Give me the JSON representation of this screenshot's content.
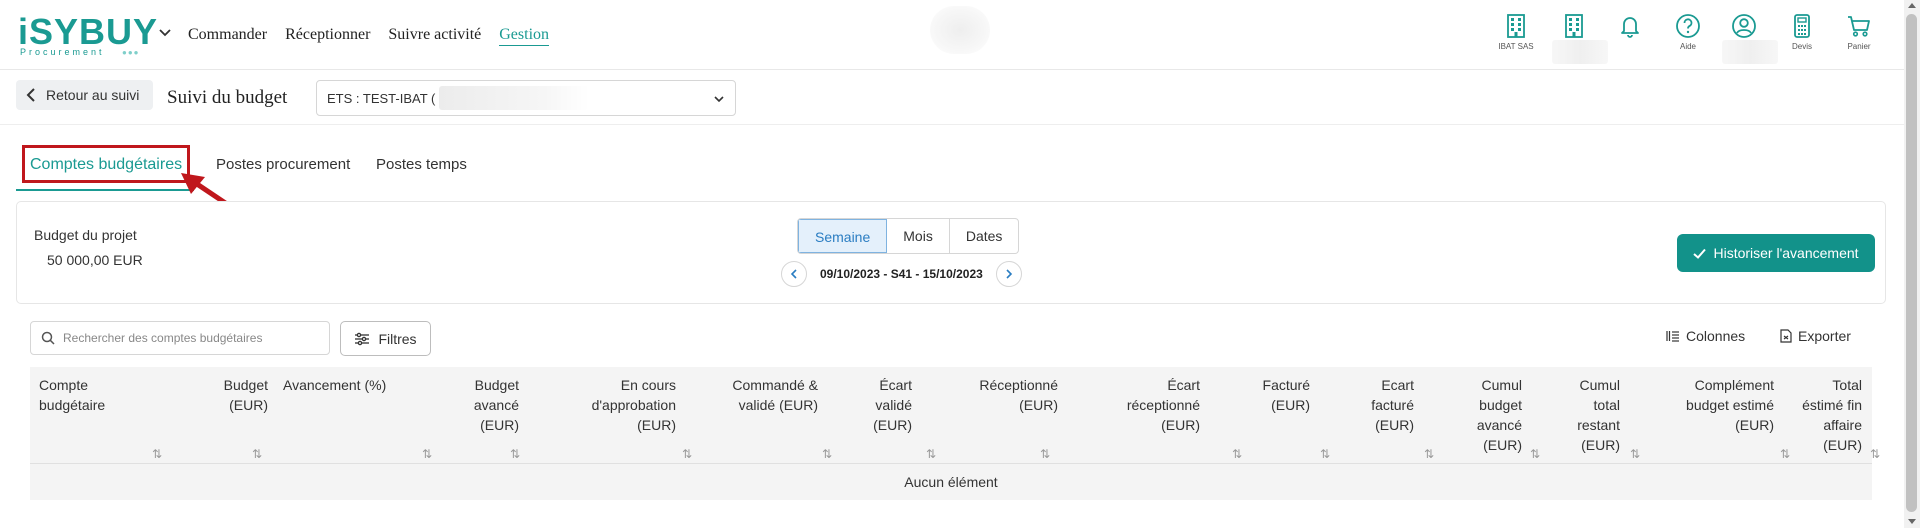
{
  "header": {
    "logo_text": "iSYBUY",
    "logo_sub": "Procurement",
    "nav": [
      {
        "label": "Commander"
      },
      {
        "label": "Réceptionner"
      },
      {
        "label": "Suivre activité"
      },
      {
        "label": "Gestion"
      }
    ],
    "icons": [
      {
        "icon": "building-icon",
        "label": "IBAT SAS"
      },
      {
        "icon": "building-icon",
        "label": ""
      },
      {
        "icon": "bell-icon",
        "label": ""
      },
      {
        "icon": "help-icon",
        "label": "Aide"
      },
      {
        "icon": "user-icon",
        "label": ""
      },
      {
        "icon": "calculator-icon",
        "label": "Devis"
      },
      {
        "icon": "cart-icon",
        "label": "Panier"
      }
    ]
  },
  "subbar": {
    "back_label": "Retour au suivi",
    "title": "Suivi du budget",
    "ets_value": "ETS : TEST-IBAT ("
  },
  "tabs": [
    {
      "label": "Comptes budgétaires",
      "active": true
    },
    {
      "label": "Postes procurement",
      "active": false
    },
    {
      "label": "Postes temps",
      "active": false
    }
  ],
  "budget": {
    "label": "Budget du projet",
    "value": "50 000,00 EUR"
  },
  "period": {
    "options": [
      "Semaine",
      "Mois",
      "Dates"
    ],
    "selected": "Semaine",
    "range": "09/10/2023 - S41 - 15/10/2023"
  },
  "actions": {
    "historize": "Historiser l'avancement",
    "columns": "Colonnes",
    "export": "Exporter",
    "filters": "Filtres"
  },
  "search": {
    "placeholder": "Rechercher des comptes budgétaires",
    "value": ""
  },
  "table": {
    "columns": [
      {
        "key": "compte",
        "lines": [
          "Compte",
          "budgétaire"
        ],
        "align": "left"
      },
      {
        "key": "budget",
        "lines": [
          "Budget",
          "(EUR)"
        ],
        "align": "right"
      },
      {
        "key": "avancement",
        "lines": [
          "Avancement (%)"
        ],
        "align": "left"
      },
      {
        "key": "budget_avance",
        "lines": [
          "Budget",
          "avancé",
          "(EUR)"
        ],
        "align": "right"
      },
      {
        "key": "en_cours",
        "lines": [
          "En cours",
          "d'approbation",
          "(EUR)"
        ],
        "align": "right"
      },
      {
        "key": "commande",
        "lines": [
          "Commandé &",
          "validé (EUR)"
        ],
        "align": "right"
      },
      {
        "key": "ecart_valide",
        "lines": [
          "Écart",
          "validé",
          "(EUR)"
        ],
        "align": "right"
      },
      {
        "key": "receptionne",
        "lines": [
          "Réceptionné",
          "(EUR)"
        ],
        "align": "right"
      },
      {
        "key": "ecart_receptionne",
        "lines": [
          "Écart",
          "réceptionné",
          "(EUR)"
        ],
        "align": "right"
      },
      {
        "key": "facture",
        "lines": [
          "Facturé",
          "(EUR)"
        ],
        "align": "right"
      },
      {
        "key": "ecart_facture",
        "lines": [
          "Ecart",
          "facturé",
          "(EUR)"
        ],
        "align": "right"
      },
      {
        "key": "cumul_budget",
        "lines": [
          "Cumul",
          "budget",
          "avancé",
          "(EUR)"
        ],
        "align": "right"
      },
      {
        "key": "cumul_restant",
        "lines": [
          "Cumul",
          "total",
          "restant",
          "(EUR)"
        ],
        "align": "right"
      },
      {
        "key": "complement",
        "lines": [
          "Complément",
          "budget estimé",
          "(EUR)"
        ],
        "align": "right"
      },
      {
        "key": "total_estime",
        "lines": [
          "Total",
          "éstimé fin",
          "affaire",
          "(EUR)"
        ],
        "align": "right"
      }
    ],
    "empty_text": "Aucun élément"
  },
  "colors": {
    "brand": "#1a9a92",
    "button": "#12928a",
    "highlight": "#c0171c",
    "segment_active": "#e4f0fb"
  }
}
